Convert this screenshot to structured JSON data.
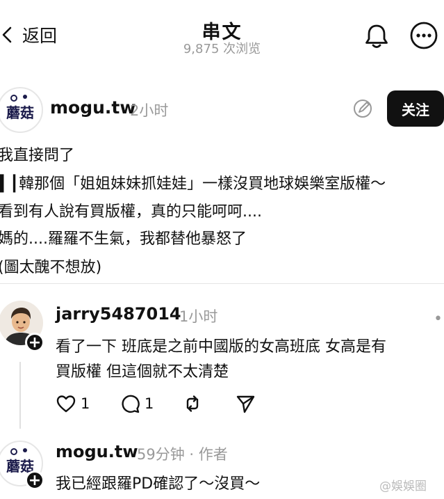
{
  "header": {
    "back_label": "返回",
    "title": "串文",
    "views": "9,875 次浏览"
  },
  "post": {
    "avatar_text": "蘑菇",
    "username": "mogu.tw",
    "time": "2小时",
    "follow_label": "关注",
    "lines": [
      "我直接問了",
      "▌┃韓那個「姐姐妹妹抓娃娃」一樣沒買地球娛樂室版權～",
      "看到有人說有買版權，真的只能呵呵....",
      "媽的....羅羅不生氣，我都替他暴怒了",
      "(圖太醜不想放)"
    ]
  },
  "comments": [
    {
      "username": "jarry5487014",
      "time": "1小时",
      "lines": [
        "看了一下 班底是之前中國版的女高班底 女高是有",
        "買版權 但這個就不太清楚"
      ],
      "likes": "1",
      "replies": "1"
    },
    {
      "username": "mogu.tw",
      "time": "59分钟 · 作者",
      "lines": [
        "我已經跟羅PD確認了～沒買～"
      ]
    }
  ],
  "watermark": "@娛娛圈"
}
